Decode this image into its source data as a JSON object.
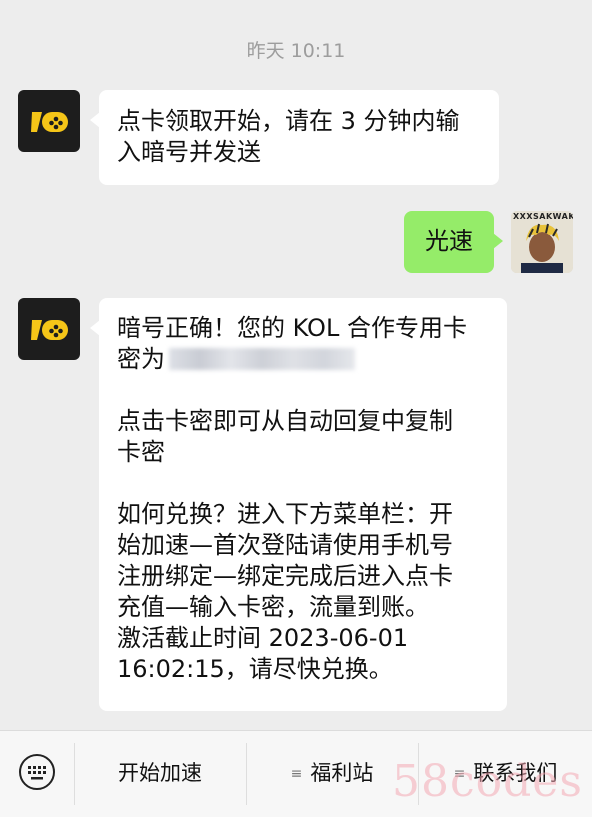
{
  "timestamp": "昨天 10:11",
  "messages": [
    {
      "sender": "bot",
      "lines": [
        "点卡领取开始，请在 3 分钟内输",
        "入暗号并发送"
      ]
    },
    {
      "sender": "user",
      "text": "光速",
      "avatar_caption": "XXXSAKWAK"
    },
    {
      "sender": "bot",
      "lines": [
        "暗号正确！您的 KOL 合作专用卡",
        "密为",
        "",
        "点击卡密即可从自动回复中复制",
        "卡密",
        "",
        "如何兑换？进入下方菜单栏：开",
        "始加速—首次登陆请使用手机号",
        "注册绑定—绑定完成后进入点卡",
        "充值—输入卡密，流量到账。",
        "激活截止时间 2023-06-01",
        "16:02:15，请尽快兑换。"
      ]
    }
  ],
  "footer_menu": {
    "keyboard_icon": "keyboard-icon",
    "items": [
      {
        "label": "开始加速",
        "icon": ""
      },
      {
        "label": "福利站",
        "icon": "≡"
      },
      {
        "label": "联系我们",
        "icon": "≡"
      }
    ]
  },
  "watermark": "58codes",
  "colors": {
    "background": "#ededed",
    "bubble_incoming": "#ffffff",
    "bubble_outgoing": "#95ec69",
    "bot_avatar_bg": "#1d1d1d",
    "bot_avatar_accent": "#f5c518"
  }
}
